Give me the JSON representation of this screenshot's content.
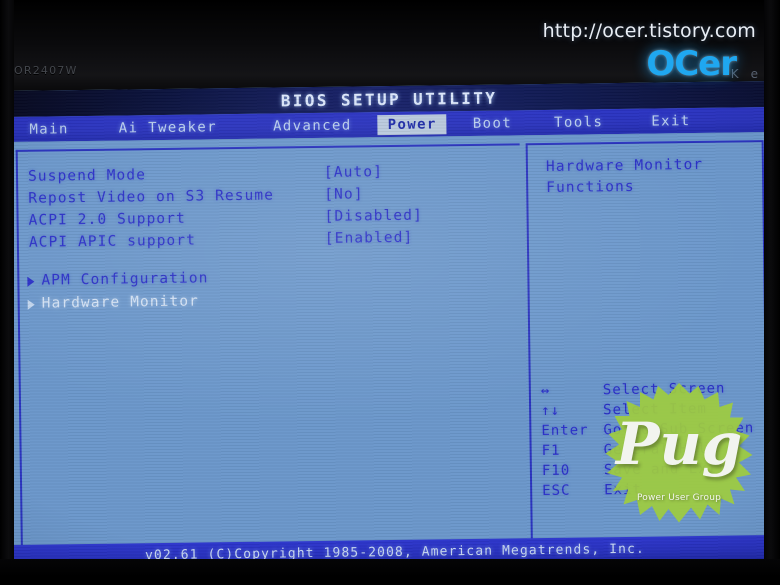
{
  "photo": {
    "monitor_model": "OR2407W",
    "bezel_logos": [
      "K",
      "e"
    ],
    "bezel_logo_captions": [
      "",
      ""
    ]
  },
  "watermarks": {
    "site_url": "http://ocer.tistory.com",
    "site_logo": "OCer",
    "pug_logo": "Pug",
    "pug_tagline": "Power User Group",
    "pug_color": "#9ecb3f"
  },
  "bios": {
    "title": "BIOS SETUP UTILITY",
    "tabs": [
      {
        "label": "Main",
        "active": false
      },
      {
        "label": "Ai Tweaker",
        "active": false
      },
      {
        "label": "Advanced",
        "active": false
      },
      {
        "label": "Power",
        "active": true
      },
      {
        "label": "Boot",
        "active": false
      },
      {
        "label": "Tools",
        "active": false
      },
      {
        "label": "Exit",
        "active": false
      }
    ],
    "settings": [
      {
        "label": "Suspend Mode",
        "value": "[Auto]"
      },
      {
        "label": "Repost Video on S3 Resume",
        "value": "[No]"
      },
      {
        "label": "ACPI 2.0 Support",
        "value": "[Disabled]"
      },
      {
        "label": "ACPI APIC support",
        "value": "[Enabled]"
      }
    ],
    "submenus": [
      {
        "label": "APM Configuration",
        "selected": false
      },
      {
        "label": "Hardware Monitor",
        "selected": true
      }
    ],
    "help": {
      "line1": "Hardware Monitor",
      "line2": "Functions"
    },
    "legend": [
      {
        "key": "↔",
        "desc": "Select Screen"
      },
      {
        "key": "↑↓",
        "desc": "Select Item"
      },
      {
        "key": "Enter",
        "desc": "Go to Sub Screen"
      },
      {
        "key": "F1",
        "desc": "General Help"
      },
      {
        "key": "F10",
        "desc": "Save and Exit"
      },
      {
        "key": "ESC",
        "desc": "Exit"
      }
    ],
    "footer": "v02.61 (C)Copyright 1985-2008, American Megatrends, Inc.",
    "colors": {
      "screen_bg": "#6b97cb",
      "text_blue": "#2a2fc8",
      "highlight_text": "#d4e2f4",
      "bar_blue": "#2b34c4",
      "tab_active_bg": "#b9c9dd"
    }
  }
}
